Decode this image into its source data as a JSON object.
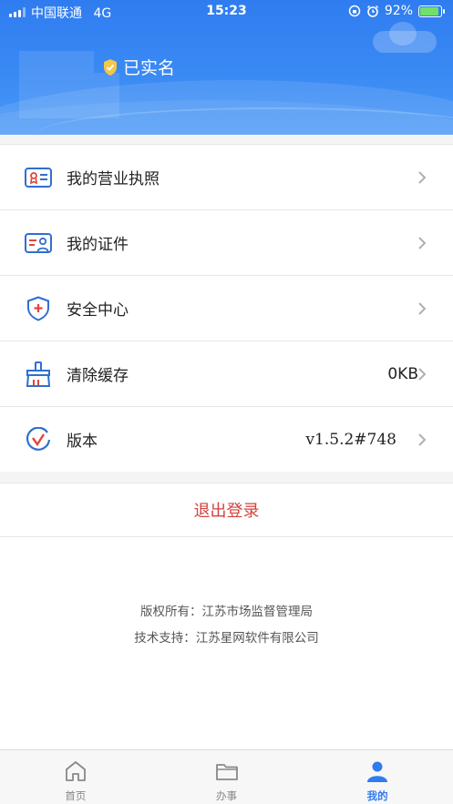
{
  "status_bar": {
    "carrier": "中国联通",
    "network": "4G",
    "time": "15:23",
    "battery": "92%",
    "battery_level": 0.92
  },
  "profile": {
    "verified_label": "已实名"
  },
  "colors": {
    "brand": "#2f7cf0",
    "logout": "#d4423d",
    "icon_blue": "#2f6fcf",
    "icon_red": "#e2453c",
    "battery_fill": "#6fe06a"
  },
  "menu": {
    "items": [
      {
        "label": "我的营业执照",
        "value": "",
        "icon": "business-license-icon"
      },
      {
        "label": "我的证件",
        "value": "",
        "icon": "id-card-icon"
      },
      {
        "label": "安全中心",
        "value": "",
        "icon": "shield-icon"
      },
      {
        "label": "清除缓存",
        "value": "0KB",
        "icon": "broom-icon"
      },
      {
        "label": "版本",
        "value": "v1.5.2#748",
        "icon": "version-icon"
      }
    ]
  },
  "logout_label": "退出登录",
  "footer": {
    "copyright": "版权所有：江苏市场监督管理局",
    "support": "技术支持：江苏星网软件有限公司"
  },
  "tabs": [
    {
      "label": "首页",
      "icon": "home-icon",
      "active": false
    },
    {
      "label": "办事",
      "icon": "folder-icon",
      "active": false
    },
    {
      "label": "我的",
      "icon": "user-icon",
      "active": true
    }
  ]
}
